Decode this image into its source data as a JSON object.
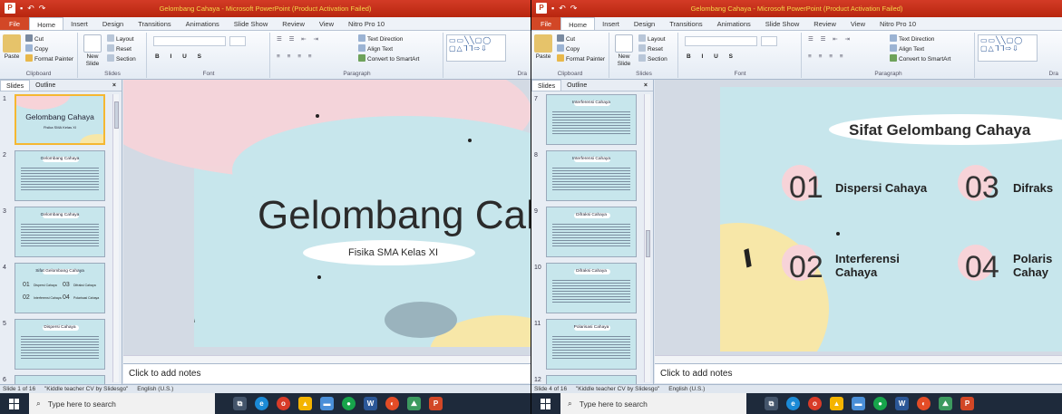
{
  "left": {
    "title": "Gelombang Cahaya - Microsoft PowerPoint (Product Activation Failed)",
    "tabs": [
      "File",
      "Home",
      "Insert",
      "Design",
      "Transitions",
      "Animations",
      "Slide Show",
      "Review",
      "View",
      "Nitro Pro 10"
    ],
    "clipboard": {
      "paste": "Paste",
      "cut": "Cut",
      "copy": "Copy",
      "format_painter": "Format Painter",
      "label": "Clipboard"
    },
    "slides_group": {
      "new_slide": "New Slide",
      "layout": "Layout",
      "reset": "Reset",
      "section": "Section",
      "label": "Slides"
    },
    "font_label": "Font",
    "paragraph": {
      "text_direction": "Text Direction",
      "align_text": "Align Text",
      "smartart": "Convert to SmartArt",
      "label": "Paragraph"
    },
    "drawing_label": "Dra",
    "panel_tabs": {
      "slides": "Slides",
      "outline": "Outline"
    },
    "thumbs": [
      {
        "num": "1",
        "title": "Gelombang Cahaya",
        "sub": "Fisika SMA Kelas XI"
      },
      {
        "num": "2",
        "title": "Gelombang Cahaya"
      },
      {
        "num": "3",
        "title": "Gelombang Cahaya"
      },
      {
        "num": "4",
        "title": "Sifat Gelombang Cahaya",
        "items": [
          "01",
          "Dispersi Cahaya",
          "03",
          "Difraksi Cahaya",
          "02",
          "Interferensi Cahaya",
          "04",
          "Polarisasi Cahaya"
        ]
      },
      {
        "num": "5",
        "title": "Dispersi Cahaya"
      },
      {
        "num": "6"
      }
    ],
    "slide": {
      "title": "Gelombang Cahaya",
      "subtitle": "Fisika SMA Kelas XI"
    },
    "notes": "Click to add notes",
    "status": {
      "slide": "Slide 1 of 16",
      "theme": "\"Kiddle teacher CV by Slidesgo\"",
      "lang": "English (U.S.)"
    }
  },
  "right": {
    "title": "Gelombang Cahaya - Microsoft PowerPoint (Product Activation Failed)",
    "tabs": [
      "File",
      "Home",
      "Insert",
      "Design",
      "Transitions",
      "Animations",
      "Slide Show",
      "Review",
      "View",
      "Nitro Pro 10"
    ],
    "thumbs": [
      {
        "num": "7",
        "title": "Interferensi Cahaya"
      },
      {
        "num": "8",
        "title": "Interferensi Cahaya"
      },
      {
        "num": "9",
        "title": "Difraksi Cahaya"
      },
      {
        "num": "10",
        "title": "Difraksi Cahaya"
      },
      {
        "num": "11",
        "title": "Polarisasi Cahaya"
      },
      {
        "num": "12"
      }
    ],
    "slide": {
      "title": "Sifat Gelombang Cahaya",
      "items": [
        {
          "num": "01",
          "label": "Dispersi Cahaya"
        },
        {
          "num": "03",
          "label": "Difraks"
        },
        {
          "num": "02",
          "label": "Interferensi Cahaya"
        },
        {
          "num": "04",
          "label": "Polaris Cahay"
        }
      ]
    },
    "notes": "Click to add notes",
    "status": {
      "slide": "Slide 4 of 16",
      "theme": "\"Kiddle teacher CV by Slidesgo\"",
      "lang": "English (U.S.)"
    }
  },
  "taskbar": {
    "search_placeholder": "Type here to search"
  },
  "colors": {
    "titlebar": "#c8321a",
    "file_tab": "#d24726",
    "slide_bg": "#c7e6ec",
    "pink": "#f7d3d8",
    "yellow": "#f7e7a8",
    "taskbar": "#1e2a3b"
  }
}
